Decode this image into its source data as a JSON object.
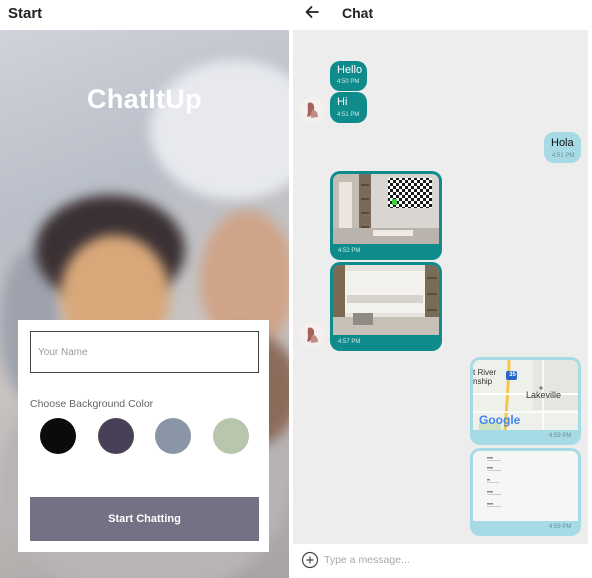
{
  "start": {
    "title": "Start",
    "app_name": "ChatItUp",
    "name_placeholder": "Your Name",
    "color_label": "Choose Background Color",
    "colors": [
      "#090C08",
      "#474056",
      "#8A95A5",
      "#B9C6AE"
    ],
    "button_label": "Start Chatting",
    "button_color": "#757083"
  },
  "chat": {
    "title": "Chat",
    "accent_color": "#0f8b8b",
    "outgoing_color": "#a6dbe6",
    "messages": [
      {
        "text": "Hello",
        "time": "4:50 PM"
      },
      {
        "text": "Hi",
        "time": "4:51 PM"
      },
      {
        "text": "Hola",
        "time": "4:51 PM"
      },
      {
        "text": "",
        "time": "4:52 PM"
      },
      {
        "text": "",
        "time": "4:57 PM"
      },
      {
        "text": "",
        "time": "4:59 PM"
      },
      {
        "text": "",
        "time": "4:59 PM"
      }
    ],
    "map": {
      "place_1": "Lakeville",
      "place_2_line1": "t River",
      "place_2_line2": "nship",
      "road_label": "35",
      "brand": "Google"
    },
    "message_placeholder": "Type a message..."
  }
}
